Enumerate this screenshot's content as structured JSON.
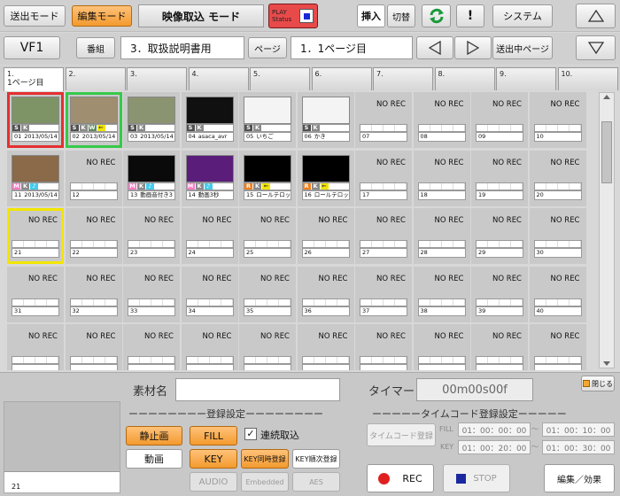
{
  "header": {
    "send_mode": "送出モード",
    "edit_mode": "編集モード",
    "title": "映像取込 モード",
    "play_status": "PLAY\nStatus",
    "insert": "挿入",
    "switch": "切替",
    "exclaim": "!",
    "system": "システム"
  },
  "row2": {
    "vf": "VF1",
    "program_label": "番組",
    "program_value": "3．取扱説明書用",
    "page_label": "ページ",
    "page_value": "1．1ページ目",
    "send_page": "送出中ページ"
  },
  "tabs": [
    {
      "num": "1.",
      "name": "1ページ目"
    },
    {
      "num": "2.",
      "name": ""
    },
    {
      "num": "3.",
      "name": ""
    },
    {
      "num": "4.",
      "name": ""
    },
    {
      "num": "5.",
      "name": ""
    },
    {
      "num": "6.",
      "name": ""
    },
    {
      "num": "7.",
      "name": ""
    },
    {
      "num": "8.",
      "name": ""
    },
    {
      "num": "9.",
      "name": ""
    },
    {
      "num": "10.",
      "name": ""
    }
  ],
  "grid_cells": [
    {
      "n": "01",
      "label": "2013/05/14",
      "tags": [
        "S",
        "K"
      ],
      "thumb": "#7f9466"
    },
    {
      "n": "02",
      "label": "2013/05/14",
      "tags": [
        "S",
        "K",
        "W",
        "←"
      ],
      "thumb": "#9f8f70"
    },
    {
      "n": "03",
      "label": "2013/05/14",
      "tags": [
        "S",
        "K"
      ],
      "thumb": "#8a9470"
    },
    {
      "n": "04",
      "label": "asaca_avr",
      "tags": [
        "S",
        "K"
      ],
      "thumb": "#101010"
    },
    {
      "n": "05",
      "label": "いちご",
      "tags": [
        "S",
        "K"
      ],
      "thumb": "#f4f4f4"
    },
    {
      "n": "06",
      "label": "かき",
      "tags": [
        "S",
        "K"
      ],
      "thumb": "#f4f4f4"
    },
    {
      "n": "07",
      "norec": "NO REC"
    },
    {
      "n": "08",
      "norec": "NO REC"
    },
    {
      "n": "09",
      "norec": "NO REC"
    },
    {
      "n": "10",
      "norec": "NO REC"
    },
    {
      "n": "11",
      "label": "2013/05/14",
      "tags": [
        "M",
        "K",
        "♪"
      ],
      "thumb": "#8a6a48"
    },
    {
      "n": "12",
      "norec": "NO REC"
    },
    {
      "n": "13",
      "label": "動画音付き3",
      "tags": [
        "M",
        "K",
        "♪"
      ],
      "thumb": "#0a0a0a"
    },
    {
      "n": "14",
      "label": "動画3秒",
      "tags": [
        "M",
        "K",
        "♪"
      ],
      "thumb": "#5a1e7a"
    },
    {
      "n": "15",
      "label": "ロールテロップ",
      "tags": [
        "R",
        "K",
        "←"
      ],
      "thumb": "#000"
    },
    {
      "n": "16",
      "label": "ロールテロップ",
      "tags": [
        "R",
        "K",
        "←"
      ],
      "thumb": "#000"
    },
    {
      "n": "17",
      "norec": "NO REC"
    },
    {
      "n": "18",
      "norec": "NO REC"
    },
    {
      "n": "19",
      "norec": "NO REC"
    },
    {
      "n": "20",
      "norec": "NO REC"
    },
    {
      "n": "21",
      "norec": "NO REC"
    },
    {
      "n": "22",
      "norec": "NO REC"
    },
    {
      "n": "23",
      "norec": "NO REC"
    },
    {
      "n": "24",
      "norec": "NO REC"
    },
    {
      "n": "25",
      "norec": "NO REC"
    },
    {
      "n": "26",
      "norec": "NO REC"
    },
    {
      "n": "27",
      "norec": "NO REC"
    },
    {
      "n": "28",
      "norec": "NO REC"
    },
    {
      "n": "29",
      "norec": "NO REC"
    },
    {
      "n": "30",
      "norec": "NO REC"
    },
    {
      "n": "31",
      "norec": "NO REC"
    },
    {
      "n": "32",
      "norec": "NO REC"
    },
    {
      "n": "33",
      "norec": "NO REC"
    },
    {
      "n": "34",
      "norec": "NO REC"
    },
    {
      "n": "35",
      "norec": "NO REC"
    },
    {
      "n": "36",
      "norec": "NO REC"
    },
    {
      "n": "37",
      "norec": "NO REC"
    },
    {
      "n": "38",
      "norec": "NO REC"
    },
    {
      "n": "39",
      "norec": "NO REC"
    },
    {
      "n": "40",
      "norec": "NO REC"
    },
    {
      "n": "",
      "norec": "NO REC"
    },
    {
      "n": "",
      "norec": "NO REC"
    },
    {
      "n": "",
      "norec": "NO REC"
    },
    {
      "n": "",
      "norec": "NO REC"
    },
    {
      "n": "",
      "norec": "NO REC"
    },
    {
      "n": "",
      "norec": "NO REC"
    },
    {
      "n": "",
      "norec": "NO REC"
    },
    {
      "n": "",
      "norec": "NO REC"
    },
    {
      "n": "",
      "norec": "NO REC"
    },
    {
      "n": "",
      "norec": "NO REC"
    }
  ],
  "bottom": {
    "material_name_label": "素材名",
    "material_name_value": "",
    "timer_label": "タイマー",
    "timer_value": "00m00s00f",
    "close": "閉じる",
    "preview_num": "21",
    "reg_settings": "ーーーーーーーー登録設定ーーーーーーーー",
    "still": "静止画",
    "fill": "FILL",
    "continuous": "連続取込",
    "movie": "動画",
    "key": "KEY",
    "key_sync": "KEY同時登録",
    "key_seq": "KEY順次登録",
    "audio": "AUDIO",
    "embedded": "Embedded",
    "aes": "AES",
    "tc_settings": "ーーーーータイムコード登録設定ーーーーー",
    "tc_reg": "タイムコード登録",
    "fill_label": "FILL",
    "key_label": "KEY",
    "tc_fill_in": "01：00：00：00",
    "tc_fill_out": "01：00：10：00",
    "tc_key_in": "01：00：20：00",
    "tc_key_out": "01：00：30：00",
    "tilde": "〜",
    "rec": "REC",
    "stop": "STOP",
    "edit_effect": "編集／効果"
  },
  "colors": {
    "orange": "#f39a2e",
    "red_sel": "#e53030",
    "green_sel": "#36c94a",
    "yellow_sel": "#f2e600",
    "tag_S": "#505050",
    "tag_K": "#8a8a8a",
    "tag_W": "#5a8a5a",
    "tag_M": "#ff7ac8",
    "tag_R": "#f0801e",
    "tag_note": "#44ccee",
    "tag_arrow": "#f2e600"
  },
  "icons": {
    "refresh": "refresh-icon",
    "up": "triangle-up-icon",
    "down": "triangle-down-icon",
    "left": "triangle-left-icon",
    "right": "triangle-right-icon",
    "scroll_up": "scroll-up-icon",
    "scroll_down": "scroll-down-icon",
    "rec_dot": "red-dot-icon",
    "stop_sq": "blue-square-icon"
  }
}
